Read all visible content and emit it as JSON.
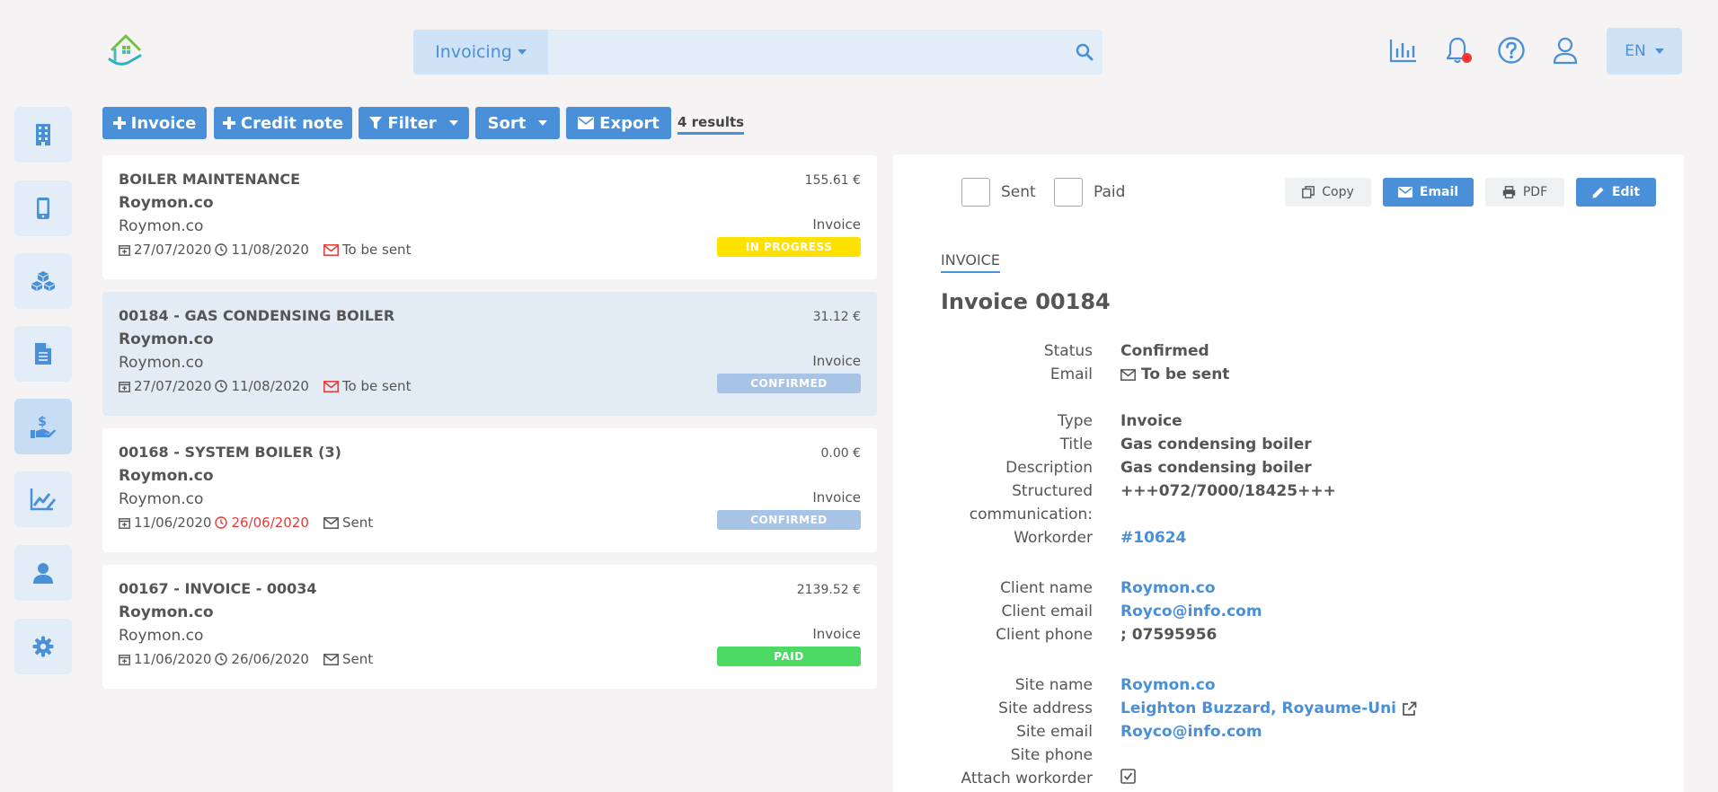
{
  "header": {
    "module_label": "Invoicing",
    "search_placeholder": "",
    "language": "EN"
  },
  "sidebar": {
    "items": [
      {
        "name": "buildings",
        "icon": "building-icon"
      },
      {
        "name": "mobile",
        "icon": "mobile-icon"
      },
      {
        "name": "stock",
        "icon": "boxes-icon"
      },
      {
        "name": "documents",
        "icon": "document-icon"
      },
      {
        "name": "invoicing",
        "icon": "hand-dollar-icon",
        "active": true
      },
      {
        "name": "reports",
        "icon": "chart-edit-icon"
      },
      {
        "name": "users",
        "icon": "user-icon"
      },
      {
        "name": "settings",
        "icon": "gear-icon"
      }
    ]
  },
  "toolbar": {
    "invoice_label": "Invoice",
    "credit_note_label": "Credit note",
    "filter_label": "Filter",
    "sort_label": "Sort",
    "export_label": "Export",
    "results": "4 results"
  },
  "list": [
    {
      "title": "BOILER MAINTENANCE",
      "client_bold": "Roymon.co",
      "client": "Roymon.co",
      "date": "27/07/2020",
      "due": "11/08/2020",
      "due_overdue": false,
      "email_status": "To be sent",
      "amount": "155.61 €",
      "kind": "Invoice",
      "status": "IN PROGRESS",
      "status_color": "#ffe100"
    },
    {
      "title": "00184 - GAS CONDENSING BOILER",
      "client_bold": "Roymon.co",
      "client": "Roymon.co",
      "date": "27/07/2020",
      "due": "11/08/2020",
      "due_overdue": false,
      "email_status": "To be sent",
      "amount": "31.12 €",
      "kind": "Invoice",
      "status": "CONFIRMED",
      "status_color": "#a7c4e6"
    },
    {
      "title": "00168 - SYSTEM BOILER (3)",
      "client_bold": "Roymon.co",
      "client": "Roymon.co",
      "date": "11/06/2020",
      "due": "26/06/2020",
      "due_overdue": true,
      "email_status": "Sent",
      "amount": "0.00 €",
      "kind": "Invoice",
      "status": "CONFIRMED",
      "status_color": "#a7c4e6"
    },
    {
      "title": "00167 - INVOICE - 00034",
      "client_bold": "Roymon.co",
      "client": "Roymon.co",
      "date": "11/06/2020",
      "due": "26/06/2020",
      "due_overdue": false,
      "email_status": "Sent",
      "amount": "2139.52 €",
      "kind": "Invoice",
      "status": "PAID",
      "status_color": "#4cd964"
    }
  ],
  "detail": {
    "sent_label": "Sent",
    "paid_label": "Paid",
    "copy_label": "Copy",
    "email_label": "Email",
    "pdf_label": "PDF",
    "edit_label": "Edit",
    "section_label": "INVOICE",
    "title": "Invoice 00184",
    "fields": {
      "status": {
        "label": "Status",
        "value": "Confirmed"
      },
      "email": {
        "label": "Email",
        "value": "To be sent"
      },
      "type": {
        "label": "Type",
        "value": "Invoice"
      },
      "title": {
        "label": "Title",
        "value": "Gas condensing boiler"
      },
      "description": {
        "label": "Description",
        "value": "Gas condensing boiler"
      },
      "structured_1": "Structured",
      "structured_2": "communication:",
      "structured_value": "+++072/7000/18425+++",
      "workorder": {
        "label": "Workorder",
        "value": "#10624"
      },
      "client_name": {
        "label": "Client name",
        "value": "Roymon.co"
      },
      "client_email": {
        "label": "Client email",
        "value": "Royco@info.com"
      },
      "client_phone": {
        "label": "Client phone",
        "value": "; 07595956"
      },
      "site_name": {
        "label": "Site name",
        "value": "Roymon.co"
      },
      "site_address": {
        "label": "Site address",
        "value": "Leighton Buzzard, Royaume-Uni"
      },
      "site_email": {
        "label": "Site email",
        "value": "Royco@info.com"
      },
      "site_phone": {
        "label": "Site phone",
        "value": ""
      },
      "attach_workorder": {
        "label": "Attach workorder",
        "checked": true
      }
    }
  },
  "colors": {
    "accent": "#4a90d9",
    "danger": "#e53935"
  }
}
